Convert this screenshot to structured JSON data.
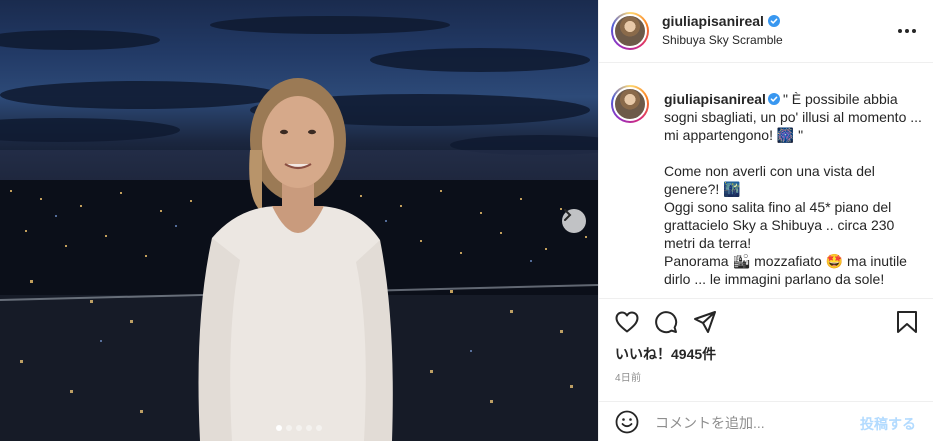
{
  "post": {
    "username": "giuliapisanireal",
    "location": "Shibuya Sky Scramble",
    "caption": "\" È possibile abbia sogni sbagliati, un po' illusi al momento ... mi appartengono! 🎆 \"\n\nCome non averli con una vista del genere?! 🌃\nOggi sono salita fino al 45* piano del grattacielo Sky a Shibuya .. circa 230 metri da terra!\nPanorama 🏙 mozzafiato 🤩 ma inutile dirlo ... le immagini parlano da sole!",
    "likes": "いいね！4945件",
    "timestamp": "4日前"
  },
  "comment_box": {
    "placeholder": "コメントを追加...",
    "post_label": "投稿する"
  },
  "carousel": {
    "count": 5,
    "active_index": 0
  },
  "icons": {
    "verified": "verified-badge-icon",
    "like": "heart-icon",
    "comment": "comment-icon",
    "share": "paper-plane-icon",
    "save": "bookmark-icon",
    "emoji": "smiley-icon",
    "more": "more-options-icon",
    "next": "chevron-right-icon"
  },
  "colors": {
    "verified": "#3897f0",
    "post_disabled": "#b3dbff",
    "border": "#efefef",
    "secondary_text": "#8e8e8e"
  }
}
